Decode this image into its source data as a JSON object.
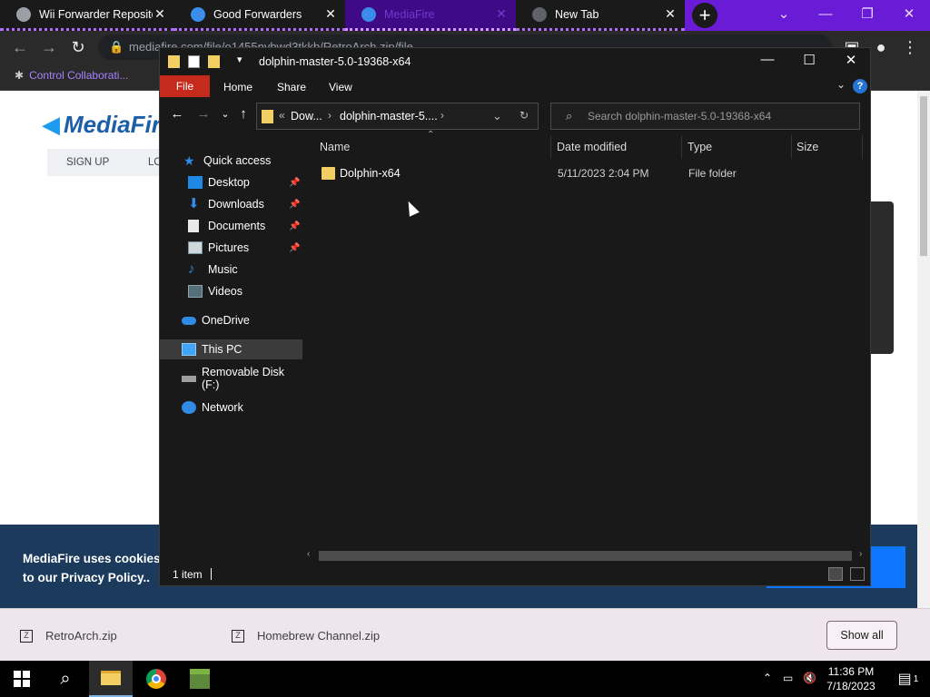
{
  "browser": {
    "tabs": [
      {
        "title": "Wii Forwarder Reposito",
        "state": "inactive"
      },
      {
        "title": "Good Forwarders",
        "state": "inactive"
      },
      {
        "title": "MediaFire",
        "state": "active"
      },
      {
        "title": "New Tab",
        "state": "inactive"
      }
    ],
    "url": "mediafire.com/file/o1455nvbwd3tkkb/RetroArch.zip/file",
    "bookmark": "Control Collaborati..."
  },
  "mediafire": {
    "logo_text": "MediaFire",
    "nav": {
      "signup": "SIGN UP",
      "login": "LO"
    },
    "cookie_line1": "MediaFire uses cookies to",
    "cookie_line2": "to our Privacy Policy.."
  },
  "downloads": {
    "items": [
      "RetroArch.zip",
      "Homebrew Channel.zip"
    ],
    "show_all": "Show all"
  },
  "explorer": {
    "title": "dolphin-master-5.0-19368-x64",
    "ribbon": {
      "file": "File",
      "home": "Home",
      "share": "Share",
      "view": "View"
    },
    "breadcrumb": [
      "Dow...",
      "dolphin-master-5...."
    ],
    "search_placeholder": "Search dolphin-master-5.0-19368-x64",
    "nav_items": [
      {
        "label": "Quick access",
        "icon": "star-icon",
        "pinned": false
      },
      {
        "label": "Desktop",
        "icon": "desktop-icon",
        "pinned": true
      },
      {
        "label": "Downloads",
        "icon": "downloads-icon",
        "pinned": true
      },
      {
        "label": "Documents",
        "icon": "documents-icon",
        "pinned": true
      },
      {
        "label": "Pictures",
        "icon": "pictures-icon",
        "pinned": true
      },
      {
        "label": "Music",
        "icon": "music-icon",
        "pinned": false
      },
      {
        "label": "Videos",
        "icon": "videos-icon",
        "pinned": false
      },
      {
        "label": "OneDrive",
        "icon": "cloud-icon",
        "pinned": false
      },
      {
        "label": "This PC",
        "icon": "pc-icon",
        "pinned": false
      },
      {
        "label": "Removable Disk (F:)",
        "icon": "drive-icon",
        "pinned": false
      },
      {
        "label": "Network",
        "icon": "network-icon",
        "pinned": false
      }
    ],
    "columns": {
      "name": "Name",
      "date": "Date modified",
      "type": "Type",
      "size": "Size"
    },
    "files": [
      {
        "name": "Dolphin-x64",
        "date": "5/11/2023 2:04 PM",
        "type": "File folder",
        "size": ""
      }
    ],
    "status": "1 item"
  },
  "taskbar": {
    "time": "11:36 PM",
    "date": "7/18/2023",
    "notifications": "1"
  },
  "colors": {
    "tabstrip": "#6a1bd6",
    "file_tab": "#c42b1c",
    "folder": "#f3cf63",
    "cookie_banner": "#1b3a5c"
  }
}
